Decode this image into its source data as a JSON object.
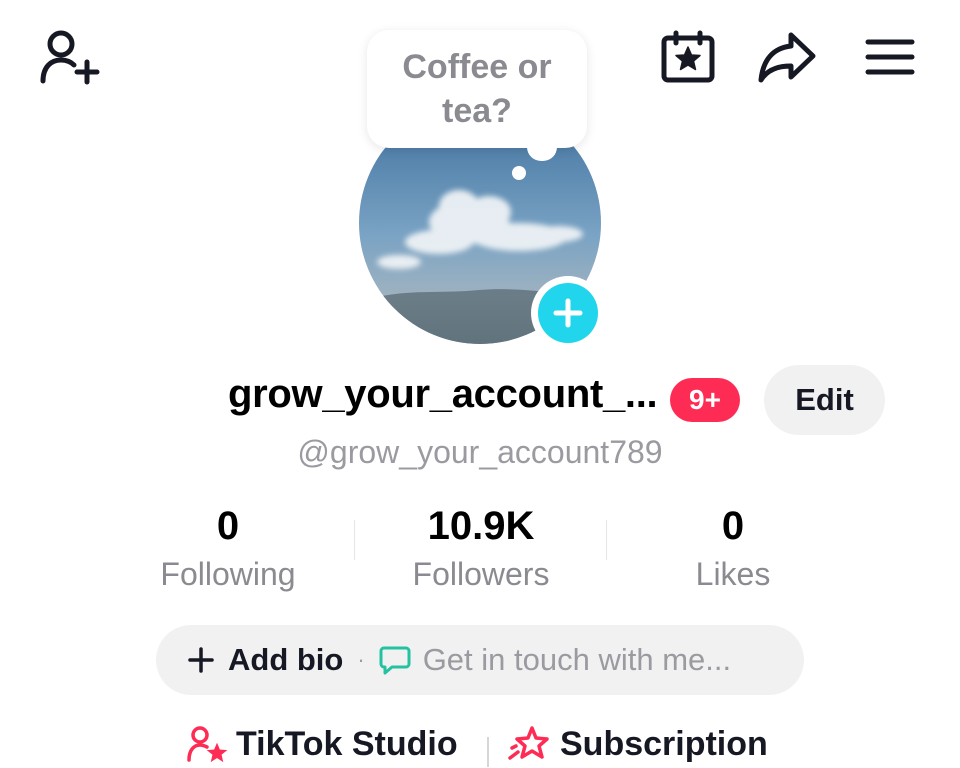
{
  "header": {
    "icons": [
      "add-friend-icon",
      "calendar-star-icon",
      "share-icon",
      "menu-icon"
    ]
  },
  "note": {
    "text": "Coffee or tea?"
  },
  "avatar": {
    "add_icon": "plus-icon"
  },
  "profile": {
    "display_name": "grow_your_account_...",
    "badge": "9+",
    "edit_label": "Edit",
    "username": "@grow_your_account789"
  },
  "stats": [
    {
      "value": "0",
      "label": "Following"
    },
    {
      "value": "10.9K",
      "label": "Followers"
    },
    {
      "value": "0",
      "label": "Likes"
    }
  ],
  "bio": {
    "add_label": "Add bio",
    "separator": "·",
    "contact_label": "Get in touch with me..."
  },
  "links": {
    "studio_label": "TikTok Studio",
    "subscription_label": "Subscription"
  },
  "colors": {
    "accent_red": "#fe2c55",
    "accent_cyan": "#20d5ec",
    "chat_green": "#25c2a0"
  }
}
